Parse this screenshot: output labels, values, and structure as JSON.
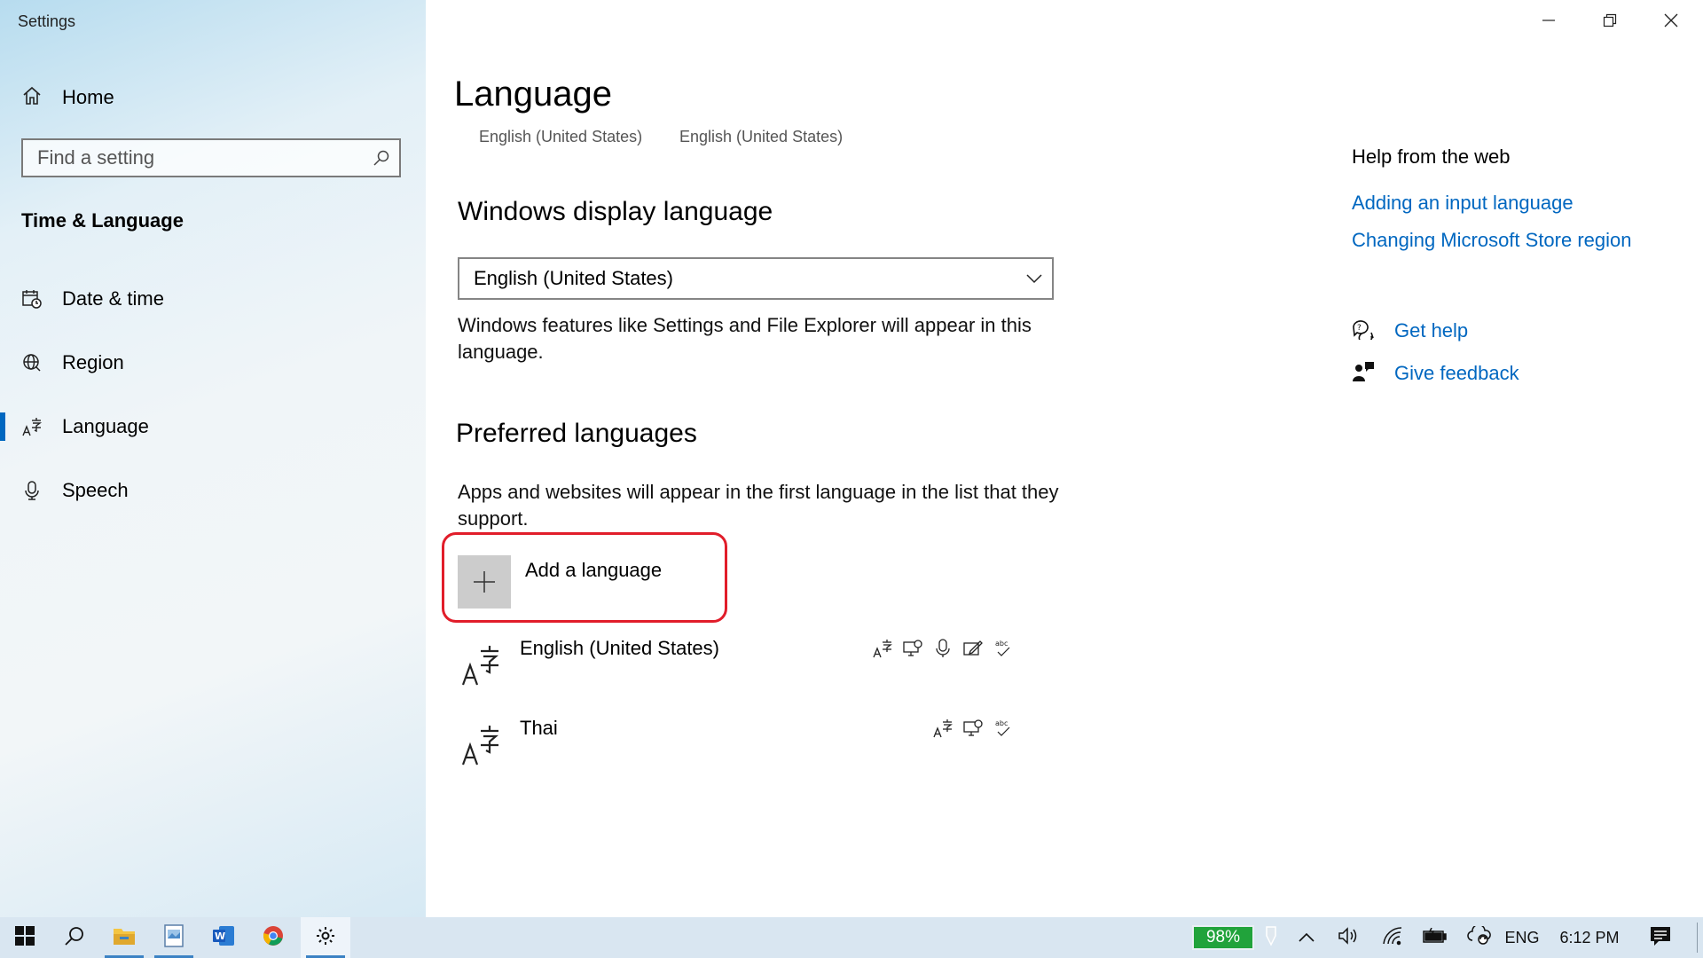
{
  "app": {
    "title": "Settings"
  },
  "sidebar": {
    "home_label": "Home",
    "search_placeholder": "Find a setting",
    "section_title": "Time & Language",
    "items": [
      {
        "label": "Date & time",
        "icon": "calendar-clock-icon"
      },
      {
        "label": "Region",
        "icon": "globe-icon"
      },
      {
        "label": "Language",
        "icon": "language-icon",
        "active": true
      },
      {
        "label": "Speech",
        "icon": "microphone-icon"
      }
    ]
  },
  "main": {
    "title": "Language",
    "header_langs": [
      "English (United States)",
      "English (United States)"
    ],
    "display_language": {
      "heading": "Windows display language",
      "selected": "English (United States)",
      "description": "Windows features like Settings and File Explorer will appear in this language."
    },
    "preferred": {
      "heading": "Preferred languages",
      "description": "Apps and websites will appear in the first language in the list that they support.",
      "add_label": "Add a language",
      "languages": [
        {
          "name": "English (United States)",
          "features": [
            "display-language-icon",
            "text-to-speech-icon",
            "speech-recognition-icon",
            "handwriting-icon",
            "spellcheck-icon"
          ]
        },
        {
          "name": "Thai",
          "features": [
            "display-language-icon",
            "text-to-speech-icon",
            "spellcheck-icon"
          ]
        }
      ]
    }
  },
  "help": {
    "title": "Help from the web",
    "links": [
      "Adding an input language",
      "Changing Microsoft Store region"
    ],
    "get_help": "Get help",
    "give_feedback": "Give feedback"
  },
  "taskbar": {
    "battery_percent": "98%",
    "language": "ENG",
    "time": "6:12 PM"
  },
  "colors": {
    "accent": "#0067c0",
    "highlight": "#e11d2a",
    "battery": "#21a33b"
  }
}
